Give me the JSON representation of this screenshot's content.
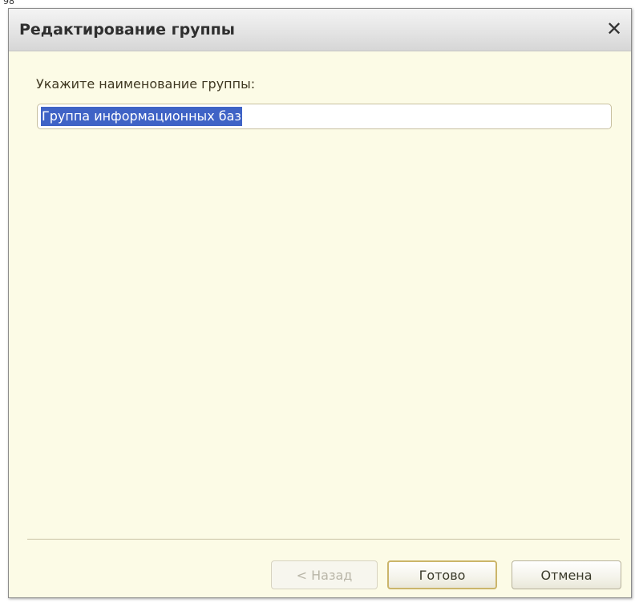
{
  "page_marker": "98",
  "dialog": {
    "title": "Редактирование группы",
    "close_symbol": "✕"
  },
  "form": {
    "label": "Укажите наименование группы:",
    "group_name_value": "Группа информационных баз"
  },
  "buttons": {
    "back_label": "< Назад",
    "done_label": "Готово",
    "cancel_label": "Отмена"
  },
  "colors": {
    "dialog_background": "#fcfbe6",
    "selection": "#3f63c6",
    "default_button_border": "#cbb56a"
  }
}
